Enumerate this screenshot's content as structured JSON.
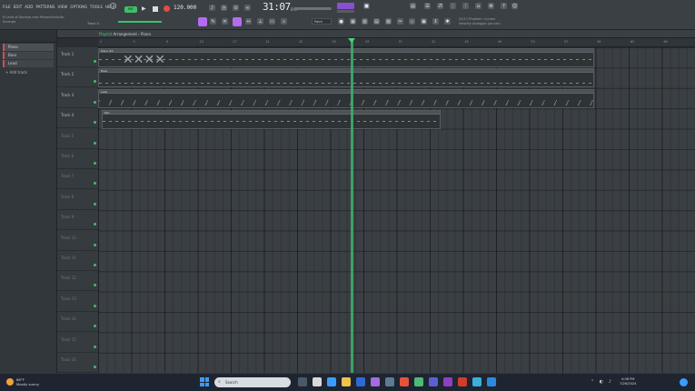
{
  "menu": [
    "FILE",
    "EDIT",
    "ADD",
    "PATTERNS",
    "VIEW",
    "OPTIONS",
    "TOOLS",
    "HELP"
  ],
  "song": {
    "title_line1": "6 Land of Springs and Melancholia.flp",
    "title_line2": "Arrange"
  },
  "transport": {
    "pattern_label": "PAT",
    "tempo": "120.000",
    "time": "31:07",
    "time_unit": "B:S",
    "track_label": "Track 4"
  },
  "snap": {
    "value": "Paint"
  },
  "hint": {
    "line1": "22/11 Problem: Curves",
    "line2": "Velocity Arpeggio (oe-ver)"
  },
  "browser": {
    "items": [
      "Piano",
      "Bass",
      "Lead"
    ],
    "add_track": "+ Add track"
  },
  "playlist": {
    "title_prefix": "Playlist",
    "title_rest": "Arrangement › Piano"
  },
  "ruler": [
    "1",
    "5",
    "9",
    "13",
    "17",
    "21",
    "25",
    "29",
    "33",
    "37",
    "41",
    "45",
    "49",
    "53",
    "57",
    "61",
    "65",
    "69"
  ],
  "tracks": [
    {
      "name": "Track 1",
      "filled": true
    },
    {
      "name": "Track 2",
      "filled": true
    },
    {
      "name": "Track 3",
      "filled": true
    },
    {
      "name": "Track 4",
      "filled": true
    },
    {
      "name": "Track 5",
      "filled": false
    },
    {
      "name": "Track 6",
      "filled": false
    },
    {
      "name": "Track 7",
      "filled": false
    },
    {
      "name": "Track 8",
      "filled": false
    },
    {
      "name": "Track 9",
      "filled": false
    },
    {
      "name": "Track 10",
      "filled": false
    },
    {
      "name": "Track 11",
      "filled": false
    },
    {
      "name": "Track 12",
      "filled": false
    },
    {
      "name": "Track 13",
      "filled": false
    },
    {
      "name": "Track 14",
      "filled": false
    },
    {
      "name": "Track 15",
      "filled": false
    },
    {
      "name": "Track 16",
      "filled": false
    }
  ],
  "clips": {
    "piano": "Piano #2",
    "bass": "Bass",
    "lead": "Lead",
    "pad": "Pad"
  },
  "taskbar": {
    "weather_temp": "68°F",
    "weather_desc": "Mostly sunny",
    "search_placeholder": "Search",
    "time": "4:08 PM",
    "date": "7/26/2024"
  },
  "colors": {
    "accent_green": "#3fbf6a",
    "accent_purple": "#b56bf0",
    "record_red": "#e0503c"
  }
}
